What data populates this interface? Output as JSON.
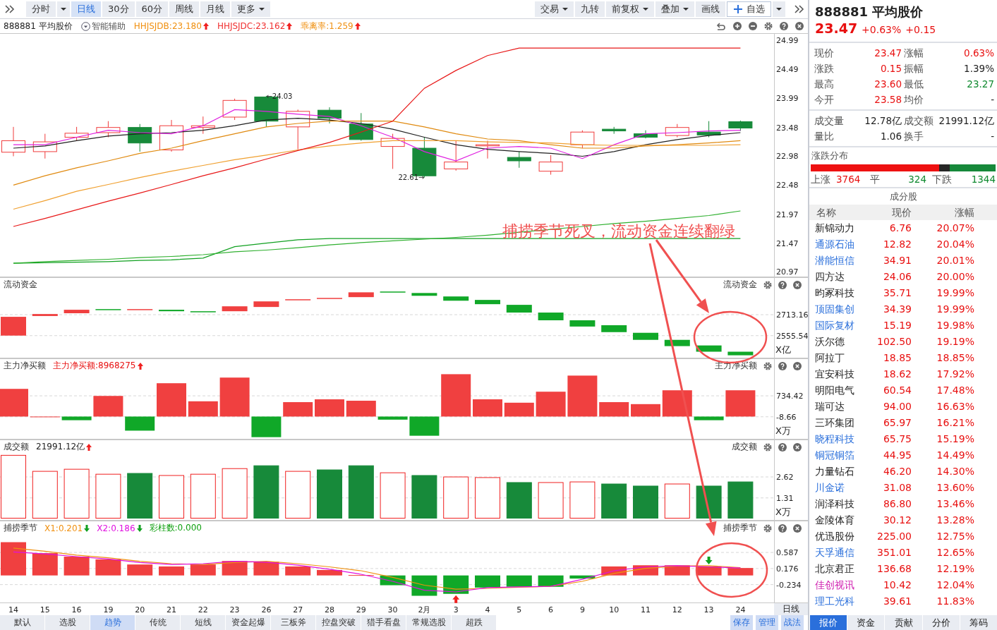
{
  "toolbar": {
    "left": [
      {
        "kind": "tab",
        "label": "分时",
        "selected": false
      },
      {
        "kind": "caret"
      },
      {
        "kind": "tab",
        "label": "日线",
        "selected": true
      },
      {
        "kind": "tab",
        "label": "30分",
        "selected": false
      },
      {
        "kind": "tab",
        "label": "60分",
        "selected": false
      },
      {
        "kind": "tab",
        "label": "周线",
        "selected": false
      },
      {
        "kind": "tab",
        "label": "月线",
        "selected": false
      },
      {
        "kind": "menu",
        "label": "更多",
        "selected": false
      }
    ],
    "right": [
      {
        "kind": "menu",
        "label": "交易"
      },
      {
        "kind": "tab",
        "label": "九转"
      },
      {
        "kind": "menu",
        "label": "前复权"
      },
      {
        "kind": "menu",
        "label": "叠加"
      },
      {
        "kind": "tab",
        "label": "画线"
      },
      {
        "kind": "add",
        "label": "自选"
      },
      {
        "kind": "caret"
      }
    ]
  },
  "chart_header": {
    "title": "888881 平均股价",
    "assist": "智能辅助",
    "legend": [
      {
        "text": "HHJSJDB:23.180",
        "color": "#f09010",
        "kind": "rise"
      },
      {
        "text": "HHJSJDC:23.162",
        "color": "#f03030",
        "kind": "rise"
      },
      {
        "text": "乖离率:1.259",
        "color": "#f09010",
        "kind": "rise"
      }
    ]
  },
  "panels": [
    {
      "kind": "price",
      "chart_data": {
        "type": "line",
        "ylim": [
          20.884,
          25.112
        ],
        "yticks": [
          24.99,
          24.49,
          23.99,
          23.48,
          22.98,
          22.48,
          21.97,
          21.47,
          20.97
        ],
        "series": [
          {
            "type": "candlestick",
            "ohlc": [
              [
                23.05,
                23.49,
                22.98,
                23.25
              ],
              [
                23.06,
                23.37,
                22.94,
                23.23
              ],
              [
                23.31,
                23.49,
                23.25,
                23.38
              ],
              [
                23.39,
                23.59,
                23.31,
                23.48
              ],
              [
                23.48,
                23.54,
                23.06,
                23.21
              ],
              [
                23.09,
                23.61,
                23.06,
                23.51
              ],
              [
                23.48,
                23.67,
                23.37,
                23.51
              ],
              [
                23.66,
                23.98,
                23.61,
                23.95
              ],
              [
                24.01,
                24.03,
                23.49,
                23.59
              ],
              [
                23.49,
                23.79,
                23.1,
                23.76
              ],
              [
                23.78,
                23.83,
                23.55,
                23.64
              ],
              [
                23.54,
                23.73,
                23.25,
                23.27
              ],
              [
                23.15,
                23.37,
                22.76,
                23.29
              ],
              [
                23.12,
                23.31,
                22.61,
                22.64
              ],
              [
                22.76,
                23.25,
                22.73,
                22.88
              ],
              [
                23.16,
                23.25,
                22.94,
                23.18
              ],
              [
                22.96,
                23.06,
                22.78,
                22.9
              ],
              [
                22.72,
                23.0,
                22.66,
                22.88
              ],
              [
                23.18,
                23.43,
                23.12,
                23.4
              ],
              [
                23.45,
                23.49,
                23.37,
                23.42
              ],
              [
                23.37,
                23.43,
                23.29,
                23.31
              ],
              [
                23.34,
                23.54,
                23.31,
                23.48
              ],
              [
                23.4,
                23.59,
                23.31,
                23.35
              ],
              [
                23.58,
                23.6,
                23.42,
                23.47
              ]
            ]
          },
          {
            "color": "#202020",
            "values": [
              23.12,
              23.16,
              23.25,
              23.33,
              23.37,
              23.39,
              23.43,
              23.51,
              23.61,
              23.64,
              23.61,
              23.55,
              23.45,
              23.31,
              23.18,
              23.1,
              23.06,
              23.03,
              22.98,
              23.06,
              23.18,
              23.27,
              23.34,
              23.39
            ]
          },
          {
            "color": "#e020e0",
            "values": [
              23.18,
              23.18,
              23.31,
              23.43,
              23.39,
              23.37,
              23.51,
              23.79,
              23.76,
              23.71,
              23.67,
              23.51,
              23.31,
              23.06,
              22.9,
              23.12,
              23.15,
              23.12,
              22.94,
              23.18,
              23.37,
              23.39,
              23.42,
              23.43
            ]
          },
          {
            "color": "#e08a10",
            "values": [
              22.48,
              22.64,
              22.78,
              22.9,
              23.03,
              23.12,
              23.25,
              23.37,
              23.49,
              23.55,
              23.59,
              23.59,
              23.59,
              23.49,
              23.37,
              23.28,
              23.25,
              23.18,
              23.12,
              23.12,
              23.16,
              23.18,
              23.21,
              23.25
            ]
          },
          {
            "color": "#f0a030",
            "values": [
              22.06,
              22.21,
              22.37,
              22.49,
              22.61,
              22.72,
              22.82,
              22.92,
              23.0,
              23.09,
              23.16,
              23.21,
              23.25,
              23.25,
              23.25,
              23.23,
              23.22,
              23.21,
              23.18,
              23.17,
              23.17,
              23.17,
              23.17,
              23.18
            ]
          },
          {
            "color": "#e81818",
            "values": [
              21.76,
              21.9,
              22.05,
              22.2,
              22.34,
              22.49,
              22.64,
              22.78,
              22.93,
              23.08,
              23.22,
              23.4,
              23.59,
              24.16,
              24.47,
              24.73,
              24.86,
              24.86,
              24.86,
              24.86,
              24.86,
              24.86,
              24.86,
              24.86
            ]
          },
          {
            "color": "#10a020",
            "values": [
              21.12,
              21.13,
              21.14,
              21.15,
              21.17,
              21.18,
              21.21,
              21.41,
              21.47,
              21.53,
              21.55,
              21.55,
              21.55,
              21.55,
              21.55,
              21.55,
              21.55,
              21.55,
              21.55,
              21.55,
              21.55,
              21.55,
              21.55,
              21.55
            ]
          },
          {
            "color": "#30b030",
            "values": [
              21.12,
              21.15,
              21.17,
              21.19,
              21.22,
              21.24,
              21.27,
              21.32,
              21.35,
              21.39,
              21.44,
              21.48,
              21.51,
              21.54,
              21.57,
              21.61,
              21.66,
              21.71,
              21.76,
              21.81,
              21.85,
              21.9,
              21.95,
              22.03
            ]
          }
        ],
        "annotations": [
          "←24.03",
          "22.61→"
        ]
      }
    },
    {
      "kind": "waterfall",
      "title": "流动资金",
      "right_title": "流动资金",
      "unit": "X亿",
      "chart_data": {
        "type": "bar",
        "grid": true,
        "ylim": [
          2387.4,
          2991.6
        ],
        "yticks": [
          2713.16,
          2555.54
        ],
        "series": [
          {
            "colors": [
              "#f04040",
              "#f04040",
              "#f04040",
              "#10a828",
              "#f04040",
              "#10a828",
              "#10a828",
              "#f04040",
              "#f04040",
              "#f04040",
              "#f04040",
              "#f04040",
              "#10a828",
              "#10a828",
              "#10a828",
              "#10a828",
              "#10a828",
              "#10a828",
              "#10a828",
              "#10a828",
              "#10a828",
              "#10a828",
              "#10a828",
              "#10a828"
            ],
            "type": "candlestick",
            "ohlc": [
              [
                2556,
                2697,
                2556,
                2697
              ],
              [
                2703,
                2718,
                2703,
                2718
              ],
              [
                2724,
                2750,
                2724,
                2750
              ],
              [
                2755,
                2755,
                2750,
                2750
              ],
              [
                2750,
                2755,
                2750,
                2755
              ],
              [
                2750,
                2750,
                2739,
                2739
              ],
              [
                2739,
                2739,
                2734,
                2734
              ],
              [
                2739,
                2776,
                2739,
                2776
              ],
              [
                2771,
                2813,
                2771,
                2813
              ],
              [
                2824,
                2829,
                2824,
                2829
              ],
              [
                2834,
                2839,
                2834,
                2839
              ],
              [
                2845,
                2881,
                2845,
                2881
              ],
              [
                2887,
                2887,
                2881,
                2881
              ],
              [
                2876,
                2876,
                2855,
                2855
              ],
              [
                2850,
                2850,
                2818,
                2818
              ],
              [
                2824,
                2824,
                2792,
                2792
              ],
              [
                2787,
                2787,
                2729,
                2729
              ],
              [
                2729,
                2729,
                2671,
                2671
              ],
              [
                2671,
                2671,
                2624,
                2624
              ],
              [
                2634,
                2634,
                2582,
                2582
              ],
              [
                2577,
                2577,
                2524,
                2524
              ],
              [
                2524,
                2524,
                2477,
                2477
              ],
              [
                2482,
                2482,
                2435,
                2435
              ],
              [
                2435,
                2435,
                2408,
                2408
              ]
            ]
          }
        ]
      }
    },
    {
      "kind": "netbuy",
      "title": "主力净买额",
      "legend": [
        {
          "text": "主力净买额:8968275",
          "color": "#e81010",
          "kind": "rise"
        }
      ],
      "right_title": "主力净买额",
      "unit": "X万",
      "chart_data": {
        "type": "bar",
        "grid": true,
        "ylim": [
          -801.4,
          2047.2
        ],
        "yticks": [
          734.42,
          -8.66
        ],
        "series": [
          {
            "colors": [
              "#f04040",
              "#f04040",
              "#10a828",
              "#f04040",
              "#10a828",
              "#f04040",
              "#f04040",
              "#f04040",
              "#10a828",
              "#f04040",
              "#f04040",
              "#f04040",
              "#10a828",
              "#10a828",
              "#f04040",
              "#f04040",
              "#f04040",
              "#f04040",
              "#f04040",
              "#f04040",
              "#f04040",
              "#f04040",
              "#10a828",
              "#f04040"
            ],
            "values": [
              980,
              0,
              -130,
              730,
              -500,
              1180,
              540,
              1380,
              -730,
              510,
              610,
              560,
              -110,
              -680,
              1500,
              610,
              490,
              880,
              1450,
              510,
              440,
              930,
              -130,
              930
            ]
          }
        ]
      }
    },
    {
      "kind": "turnover",
      "title": "成交额",
      "legend": [
        {
          "text": "21991.12亿",
          "color": "#222222",
          "kind": "rise"
        }
      ],
      "right_title": "成交额",
      "unit": "X万",
      "chart_data": {
        "type": "bar",
        "grid": true,
        "ylim": [
          -0.088,
          4.934
        ],
        "yticks": [
          2.62,
          1.31
        ],
        "series": [
          {
            "colors": [
              "#f02020",
              "#f02020",
              "#f02020",
              "#f02020",
              "#178a3a",
              "#f02020",
              "#f02020",
              "#f02020",
              "#178a3a",
              "#f02020",
              "#178a3a",
              "#178a3a",
              "#f02020",
              "#178a3a",
              "#f02020",
              "#f02020",
              "#178a3a",
              "#f02020",
              "#f02020",
              "#178a3a",
              "#178a3a",
              "#f02020",
              "#178a3a",
              "#178a3a"
            ],
            "values": [
              3.97,
              2.97,
              3.1,
              2.79,
              2.84,
              2.71,
              2.79,
              3.14,
              3.32,
              2.97,
              3.06,
              3.32,
              2.88,
              2.71,
              2.62,
              2.58,
              2.27,
              2.27,
              2.31,
              2.18,
              2.05,
              2.18,
              2.05,
              2.31
            ]
          }
        ]
      }
    },
    {
      "kind": "oscillator",
      "title": "捕捞季节",
      "legend": [
        {
          "text": "X1:0.201",
          "color": "#f09010",
          "kind": "fall"
        },
        {
          "text": "X2:0.186",
          "color": "#e010e0",
          "kind": "fall"
        },
        {
          "text": "彩柱数:0.000",
          "color": "#10a010",
          "kind": "plain"
        }
      ],
      "right_title": "捕捞季节",
      "chart_data": {
        "type": "bar",
        "grid": true,
        "ylim": [
          -0.7,
          1.391
        ],
        "yticks": [
          0.587,
          0.176,
          -0.234
        ],
        "categories": [
          "14",
          "15",
          "16",
          "19",
          "20",
          "21",
          "22",
          "23",
          "26",
          "27",
          "28",
          "29",
          "30",
          "2月",
          "3",
          "4",
          "5",
          "6",
          "9",
          "10",
          "11",
          "12",
          "13",
          "24"
        ],
        "series": [
          {
            "colors": [
              "#f04040",
              "#f04040",
              "#f04040",
              "#f04040",
              "#f04040",
              "#f04040",
              "#f04040",
              "#f04040",
              "#f04040",
              "#f04040",
              "#f04040",
              "#f04040",
              "#10a828",
              "#10a828",
              "#10a828",
              "#10a828",
              "#10a828",
              "#10a828",
              "#10a828",
              "#f04040",
              "#f04040",
              "#f04040",
              "#f04040",
              "#f04040"
            ],
            "values": [
              0.85,
              0.57,
              0.48,
              0.41,
              0.28,
              0.23,
              0.28,
              0.37,
              0.35,
              0.23,
              0.14,
              0.01,
              -0.25,
              -0.52,
              -0.47,
              -0.31,
              -0.29,
              -0.29,
              -0.08,
              0.23,
              0.26,
              0.26,
              0.23,
              0.19
            ]
          },
          {
            "type": "line",
            "color": "#f09010",
            "values": [
              0.7,
              0.62,
              0.52,
              0.45,
              0.36,
              0.3,
              0.28,
              0.33,
              0.36,
              0.3,
              0.22,
              0.12,
              -0.05,
              -0.25,
              -0.35,
              -0.33,
              -0.3,
              -0.28,
              -0.15,
              0.05,
              0.18,
              0.24,
              0.25,
              0.2
            ]
          },
          {
            "type": "line",
            "color": "#e010e0",
            "values": [
              0.6,
              0.55,
              0.48,
              0.42,
              0.33,
              0.28,
              0.3,
              0.36,
              0.34,
              0.26,
              0.16,
              0.03,
              -0.15,
              -0.38,
              -0.42,
              -0.31,
              -0.29,
              -0.28,
              -0.1,
              0.12,
              0.22,
              0.25,
              0.22,
              0.19
            ]
          }
        ],
        "annotations": [
          {
            "x": "3"
          },
          {
            "x": "13"
          }
        ]
      }
    }
  ],
  "x_axis": {
    "period": "日线"
  },
  "annotation": {
    "text": "捕捞季节死叉，流动资金连续翻绿"
  },
  "bottom_bar": {
    "tabs": [
      {
        "label": "默认",
        "selected": false
      },
      {
        "label": "选股",
        "selected": false
      },
      {
        "label": "趋势",
        "selected": true
      },
      {
        "label": "传统",
        "selected": false
      },
      {
        "label": "短线",
        "selected": false
      },
      {
        "label": "资金起爆",
        "selected": false
      },
      {
        "label": "三板斧",
        "selected": false
      },
      {
        "label": "控盘突破",
        "selected": false
      },
      {
        "label": "猎手看盘",
        "selected": false
      },
      {
        "label": "常规选股",
        "selected": false
      },
      {
        "label": "超跌",
        "selected": false
      }
    ],
    "actions": [
      "保存",
      "管理",
      "战法"
    ]
  },
  "quote": {
    "title": "888881 平均股价",
    "price": "23.47",
    "change_pct": "+0.63%",
    "change": "+0.15",
    "sections": [
      [
        {
          "label": "现价",
          "value": "23.47",
          "color": "#e81010"
        },
        {
          "label": "涨幅",
          "value": "0.63%",
          "color": "#e81010"
        },
        {
          "label": "涨跌",
          "value": "0.15",
          "color": "#e81010"
        },
        {
          "label": "振幅",
          "value": "1.39%",
          "color": "#222222"
        },
        {
          "label": "最高",
          "value": "23.60",
          "color": "#e81010"
        },
        {
          "label": "最低",
          "value": "23.27",
          "color": "#108a30"
        },
        {
          "label": "今开",
          "value": "23.58",
          "color": "#e81010"
        },
        {
          "label": "均价",
          "value": "-",
          "color": "#222222"
        }
      ],
      [
        {
          "label": "成交量",
          "value": "12.78亿",
          "color": "#222222"
        },
        {
          "label": "成交额",
          "value": "21991.12亿",
          "color": "#222222"
        },
        {
          "label": "量比",
          "value": "1.06",
          "color": "#222222"
        },
        {
          "label": "换手",
          "value": "-",
          "color": "#222222"
        }
      ]
    ],
    "distribution": {
      "title": "涨跌分布",
      "up": {
        "label": "上涨",
        "count": "3764"
      },
      "flat": {
        "label": "平",
        "count": "324"
      },
      "down": {
        "label": "下跌",
        "count": "1344"
      }
    },
    "constituents": {
      "title": "成分股",
      "columns": [
        "名称",
        "现价",
        "涨幅"
      ],
      "rows": [
        {
          "name": "新锦动力",
          "price": "6.76",
          "change": "20.07%"
        },
        {
          "name": "通源石油",
          "price": "12.82",
          "change": "20.04%",
          "color": "#2a6fdb"
        },
        {
          "name": "潜能恒信",
          "price": "34.91",
          "change": "20.01%",
          "color": "#2a6fdb"
        },
        {
          "name": "四方达",
          "price": "24.06",
          "change": "20.00%"
        },
        {
          "name": "昀冢科技",
          "price": "35.71",
          "change": "19.99%"
        },
        {
          "name": "顶固集创",
          "price": "34.39",
          "change": "19.99%",
          "color": "#2a6fdb"
        },
        {
          "name": "国际复材",
          "price": "15.19",
          "change": "19.98%",
          "color": "#2a6fdb"
        },
        {
          "name": "沃尔德",
          "price": "102.50",
          "change": "19.19%"
        },
        {
          "name": "阿拉丁",
          "price": "18.85",
          "change": "18.85%"
        },
        {
          "name": "宜安科技",
          "price": "18.62",
          "change": "17.92%"
        },
        {
          "name": "明阳电气",
          "price": "60.54",
          "change": "17.48%"
        },
        {
          "name": "瑞可达",
          "price": "94.00",
          "change": "16.63%"
        },
        {
          "name": "三环集团",
          "price": "65.97",
          "change": "16.21%"
        },
        {
          "name": "晓程科技",
          "price": "65.75",
          "change": "15.19%",
          "color": "#2a6fdb"
        },
        {
          "name": "铜冠铜箔",
          "price": "44.95",
          "change": "14.49%",
          "color": "#2a6fdb"
        },
        {
          "name": "力量钻石",
          "price": "46.20",
          "change": "14.30%"
        },
        {
          "name": "川金诺",
          "price": "31.08",
          "change": "13.60%",
          "color": "#2a6fdb"
        },
        {
          "name": "润泽科技",
          "price": "86.80",
          "change": "13.46%"
        },
        {
          "name": "金陵体育",
          "price": "30.12",
          "change": "13.28%"
        },
        {
          "name": "优迅股份",
          "price": "225.00",
          "change": "12.75%"
        },
        {
          "name": "天孚通信",
          "price": "351.01",
          "change": "12.65%",
          "color": "#2a6fdb"
        },
        {
          "name": "北京君正",
          "price": "136.68",
          "change": "12.19%"
        },
        {
          "name": "佳创视讯",
          "price": "10.42",
          "change": "12.04%",
          "color": "#d020b0"
        },
        {
          "name": "理工光科",
          "price": "39.61",
          "change": "11.83%",
          "color": "#2a6fdb"
        }
      ]
    }
  },
  "right_tabs": [
    {
      "label": "报价",
      "selected": true
    },
    {
      "label": "资金",
      "selected": false
    },
    {
      "label": "贡献",
      "selected": false
    },
    {
      "label": "分价",
      "selected": false
    },
    {
      "label": "筹码",
      "selected": false
    }
  ]
}
